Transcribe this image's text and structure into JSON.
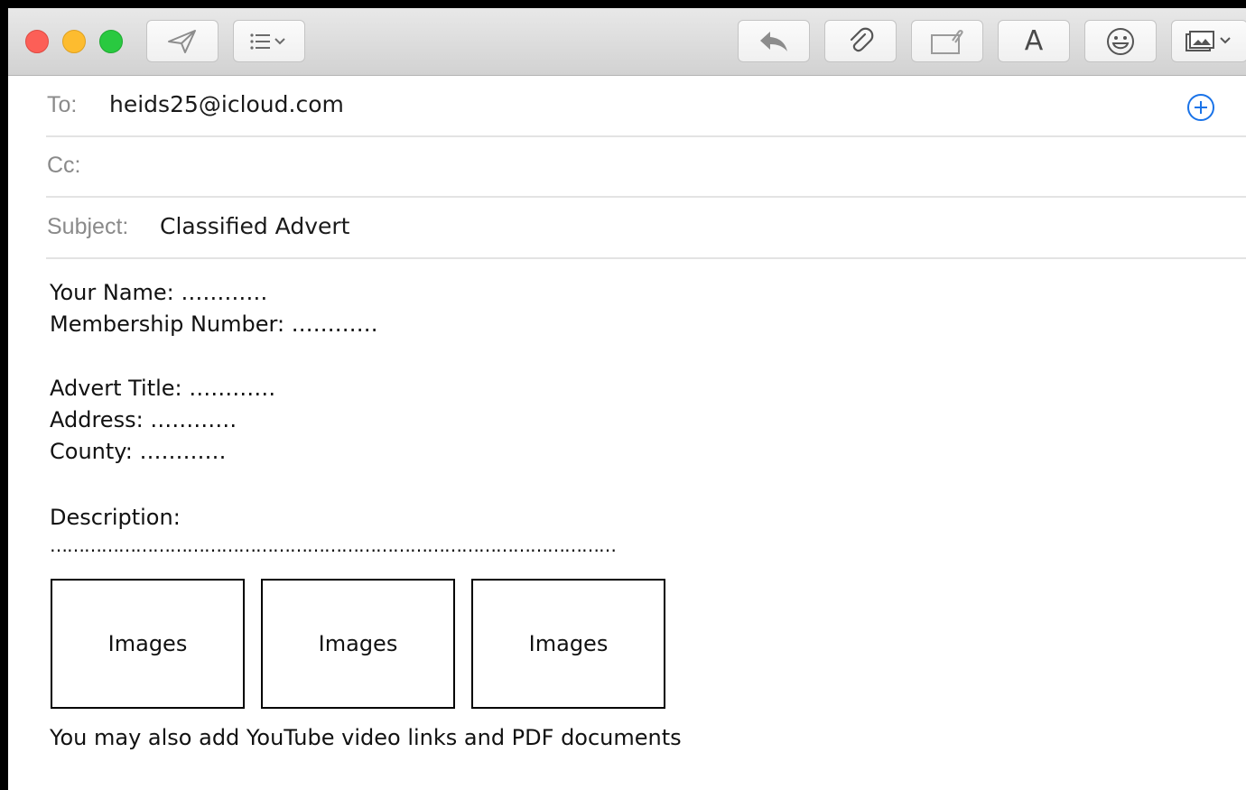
{
  "toolbar": {
    "send_icon": "paper-plane-icon",
    "header_fields_icon": "list-chevron-icon",
    "reply_icon": "reply-arrow-icon",
    "attach_icon": "paperclip-icon",
    "markup_icon": "attachment-markup-icon",
    "format_letter": "A",
    "emoji_icon": "smiley-icon",
    "photo_icon": "photo-browser-icon"
  },
  "header": {
    "to_label": "To:",
    "to_value": "heids25@icloud.com",
    "cc_label": "Cc:",
    "cc_value": "",
    "subject_label": "Subject:",
    "subject_value": "Classified Advert",
    "add_recipient_icon": "plus-circle-icon",
    "accent": "#1a73e8"
  },
  "body": {
    "your_name": "Your Name: …………",
    "membership": "Membership Number: …………",
    "advert_title": "Advert Title: …………",
    "address": "Address: …………",
    "county": "County: …………",
    "description_label": "Description:",
    "description_dots": "………………………………………………………………………………………",
    "images": [
      "Images",
      "Images",
      "Images"
    ],
    "footer_note": "You may also add YouTube video links and PDF documents"
  }
}
